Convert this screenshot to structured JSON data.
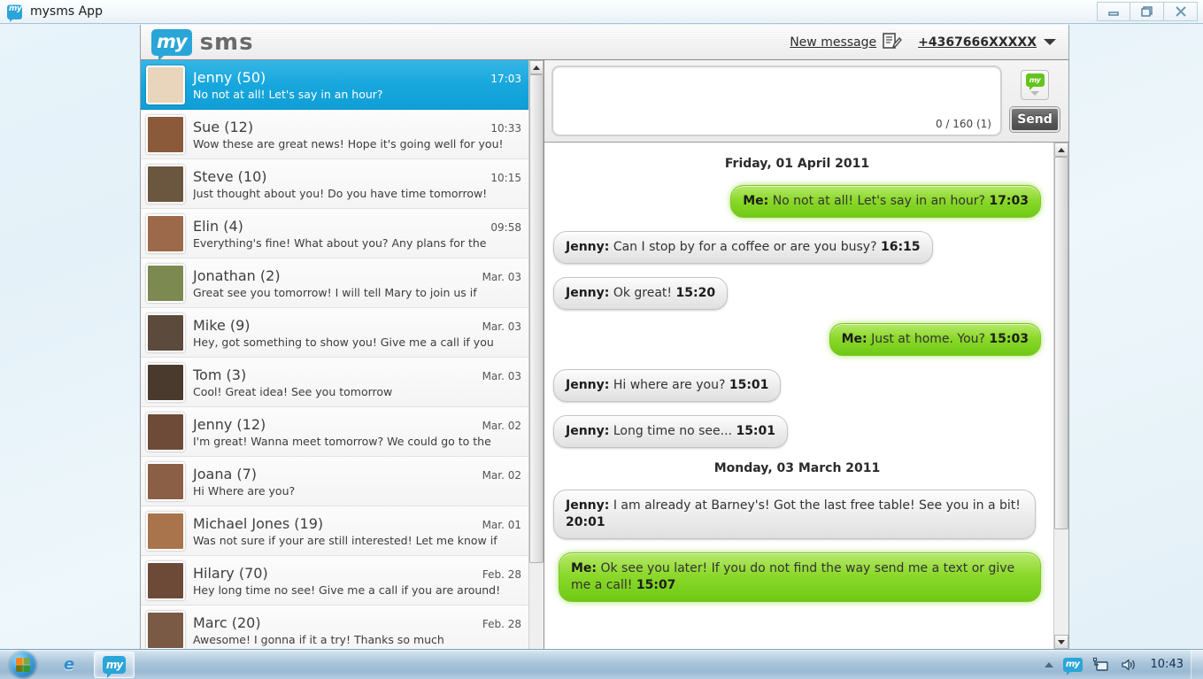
{
  "window": {
    "title": "mysms App",
    "app_icon": "mysms-bubble-icon",
    "controls": {
      "minimize": "minimize-icon",
      "restore": "restore-icon",
      "close": "close-icon"
    }
  },
  "app_header": {
    "logo_my": "my",
    "logo_sms": "sms",
    "new_message_label": "New message",
    "new_message_icon": "compose-icon",
    "phone_number": "+4367666XXXXX",
    "account_caret": "chevron-down-icon"
  },
  "conversations": [
    {
      "name": "Jenny (50)",
      "time": "17:03",
      "preview": "No not at all! Let's say in an hour?",
      "selected": true,
      "avatar": "#e8d5bb"
    },
    {
      "name": "Sue (12)",
      "time": "10:33",
      "preview": "Wow these are great news! Hope it's going well for you!",
      "selected": false,
      "avatar": "#8a5a3b"
    },
    {
      "name": "Steve (10)",
      "time": "10:15",
      "preview": "Just thought about you! Do you have time tomorrow!",
      "selected": false,
      "avatar": "#6b5640"
    },
    {
      "name": "Elin (4)",
      "time": "09:58",
      "preview": "Everything's fine! What about you? Any plans for the",
      "selected": false,
      "avatar": "#9c6a4a"
    },
    {
      "name": "Jonathan (2)",
      "time": "Mar. 03",
      "preview": "Great see you tomorrow! I will tell Mary to join us if",
      "selected": false,
      "avatar": "#7c8a52"
    },
    {
      "name": "Mike (9)",
      "time": "Mar. 03",
      "preview": "Hey, got something to show you! Give me a call if you",
      "selected": false,
      "avatar": "#5c4a3c"
    },
    {
      "name": "Tom (3)",
      "time": "Mar. 03",
      "preview": "Cool! Great idea! See you tomorrow",
      "selected": false,
      "avatar": "#4a3a2e"
    },
    {
      "name": "Jenny (12)",
      "time": "Mar. 02",
      "preview": "I'm great! Wanna meet tomorrow? We could go to the",
      "selected": false,
      "avatar": "#6e4b38"
    },
    {
      "name": "Joana (7)",
      "time": "Mar. 02",
      "preview": "Hi Where are you?",
      "selected": false,
      "avatar": "#8b5f45"
    },
    {
      "name": "Michael Jones (19)",
      "time": "Mar. 01",
      "preview": "Was not sure if your are still interested! Let me know if",
      "selected": false,
      "avatar": "#a9734c"
    },
    {
      "name": "Hilary (70)",
      "time": "Feb. 28",
      "preview": "Hey long time no see! Give me a call if you are around!",
      "selected": false,
      "avatar": "#6d4a38"
    },
    {
      "name": "Marc (20)",
      "time": "Feb. 28",
      "preview": "Awesome! I gonna if it a try! Thanks so much",
      "selected": false,
      "avatar": "#7a5a44"
    }
  ],
  "compose": {
    "value": "",
    "placeholder": "",
    "counter": "0 / 160 (1)",
    "template_icon": "mysms-template-icon",
    "template_caret": "chevron-down-icon",
    "send_label": "Send"
  },
  "thread": [
    {
      "kind": "day",
      "text": "Friday, 01 April 2011"
    },
    {
      "kind": "message",
      "direction": "out",
      "sender": "Me:",
      "body": "No not at all! Let's say in an hour?",
      "time": "17:03"
    },
    {
      "kind": "message",
      "direction": "in",
      "sender": "Jenny:",
      "body": "Can I stop by for a coffee or are you busy?",
      "time": "16:15"
    },
    {
      "kind": "message",
      "direction": "in",
      "sender": "Jenny:",
      "body": "Ok great!",
      "time": "15:20"
    },
    {
      "kind": "message",
      "direction": "out",
      "sender": "Me:",
      "body": "Just at home. You?",
      "time": "15:03"
    },
    {
      "kind": "message",
      "direction": "in",
      "sender": "Jenny:",
      "body": "Hi where are you?",
      "time": "15:01"
    },
    {
      "kind": "message",
      "direction": "in",
      "sender": "Jenny:",
      "body": "Long time no see...",
      "time": "15:01"
    },
    {
      "kind": "day",
      "text": "Monday, 03 March 2011"
    },
    {
      "kind": "message",
      "direction": "in",
      "sender": "Jenny:",
      "body": "I am already at Barney's! Got the last free table! See you in a bit!",
      "time": "20:01"
    },
    {
      "kind": "message",
      "direction": "out",
      "sender": "Me:",
      "body": "Ok see you later! If you do not find the way send me a text or give me a call!",
      "time": "15:07"
    }
  ],
  "taskbar": {
    "start_icon": "windows-start-orb-icon",
    "items": [
      {
        "icon": "internet-explorer-icon",
        "label": "e",
        "active": false
      },
      {
        "icon": "mysms-taskbar-icon",
        "label": "my",
        "active": true
      }
    ],
    "tray": {
      "overflow_icon": "show-hidden-icons-arrow-icon",
      "mysms_icon": "mysms-tray-icon",
      "network_icon": "network-icon",
      "volume_icon": "volume-icon",
      "clock": "10:43"
    }
  },
  "colors": {
    "accent_blue": "#18a7dd",
    "bubble_out_green": "#8cd92b",
    "bubble_in_gray": "#ececec",
    "header_gray": "#bdbdbd"
  }
}
